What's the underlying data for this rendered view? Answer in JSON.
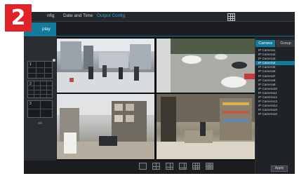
{
  "badge": {
    "number": "2"
  },
  "menubar": {
    "items": [
      {
        "label": "nfig"
      },
      {
        "label": "Date and Time"
      },
      {
        "label": "Output Config"
      }
    ]
  },
  "tab": {
    "label": "play"
  },
  "layouts": [
    {
      "label": "1"
    },
    {
      "label": "2"
    },
    {
      "label": "3"
    }
  ],
  "camera_panel": {
    "tabs": [
      {
        "label": "Camera"
      },
      {
        "label": "Group"
      }
    ],
    "cameras": [
      "IP Camera1",
      "IP Camera2",
      "IP Camera3",
      "IP Camera4",
      "IP Camera5",
      "IP Camera6",
      "IP Camera7",
      "IP Camera8",
      "IP Camera9",
      "IP Camera10",
      "IP Camera11",
      "IP Camera12",
      "IP Camera13",
      "IP Camera14",
      "IP Camera15",
      "IP Camera16"
    ],
    "selected_index": 3
  },
  "apply_label": "Apply"
}
